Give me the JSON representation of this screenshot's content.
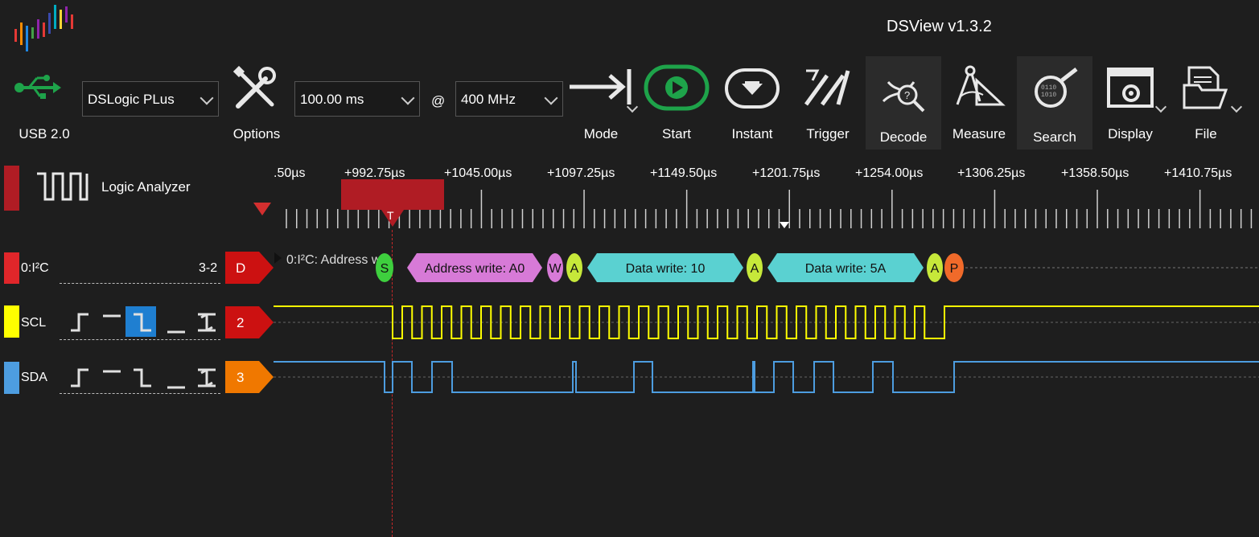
{
  "app": {
    "title": "DSView v1.3.2",
    "logo_icon": "dsview-logo-icon"
  },
  "toolbar": {
    "usb_label": "USB 2.0",
    "device": "DSLogic PLus",
    "options_label": "Options",
    "duration": "100.00 ms",
    "at_symbol": "@",
    "samplerate": "400 MHz",
    "mode_label": "Mode",
    "start_label": "Start",
    "instant_label": "Instant",
    "trigger_label": "Trigger",
    "decode_label": "Decode",
    "measure_label": "Measure",
    "search_label": "Search",
    "display_label": "Display",
    "file_label": "File",
    "colors": {
      "start_green": "#1ea34a",
      "usb_green": "#1ea34a"
    }
  },
  "sidebar": {
    "panel_title": "Logic Analyzer",
    "decoder": {
      "name": "0:I²C",
      "channels": "3-2",
      "badge": "D",
      "color": "#e0262a"
    },
    "channels": [
      {
        "name": "SCL",
        "badge": "2",
        "color": "#ffff00",
        "badge_color": "#cc1111",
        "active_trigger": 2
      },
      {
        "name": "SDA",
        "badge": "3",
        "color": "#4d9de0",
        "badge_color": "#f07800",
        "active_trigger": -1
      }
    ]
  },
  "ruler": {
    "labels": [
      ".50µs",
      "+992.75µs",
      "+1045.00µs",
      "+1097.25µs",
      "+1149.50µs",
      "+1201.75µs",
      "+1254.00µs",
      "+1306.25µs",
      "+1358.50µs",
      "+1410.75µs"
    ],
    "trigger_marker": "T"
  },
  "decode": {
    "prefix": "0:I²C: Address wri",
    "annotations": [
      {
        "text": "S",
        "color": "#3ecf3e"
      },
      {
        "text": "Address write: A0",
        "color": "#d77ad7"
      },
      {
        "text": "W",
        "color": "#d77ad7"
      },
      {
        "text": "A",
        "color": "#c6e83a"
      },
      {
        "text": "Data write: 10",
        "color": "#5ad1d1"
      },
      {
        "text": "A",
        "color": "#c6e83a"
      },
      {
        "text": "Data write: 5A",
        "color": "#5ad1d1"
      },
      {
        "text": "A",
        "color": "#c6e83a"
      },
      {
        "text": "P",
        "color": "#f06a2a"
      }
    ]
  }
}
